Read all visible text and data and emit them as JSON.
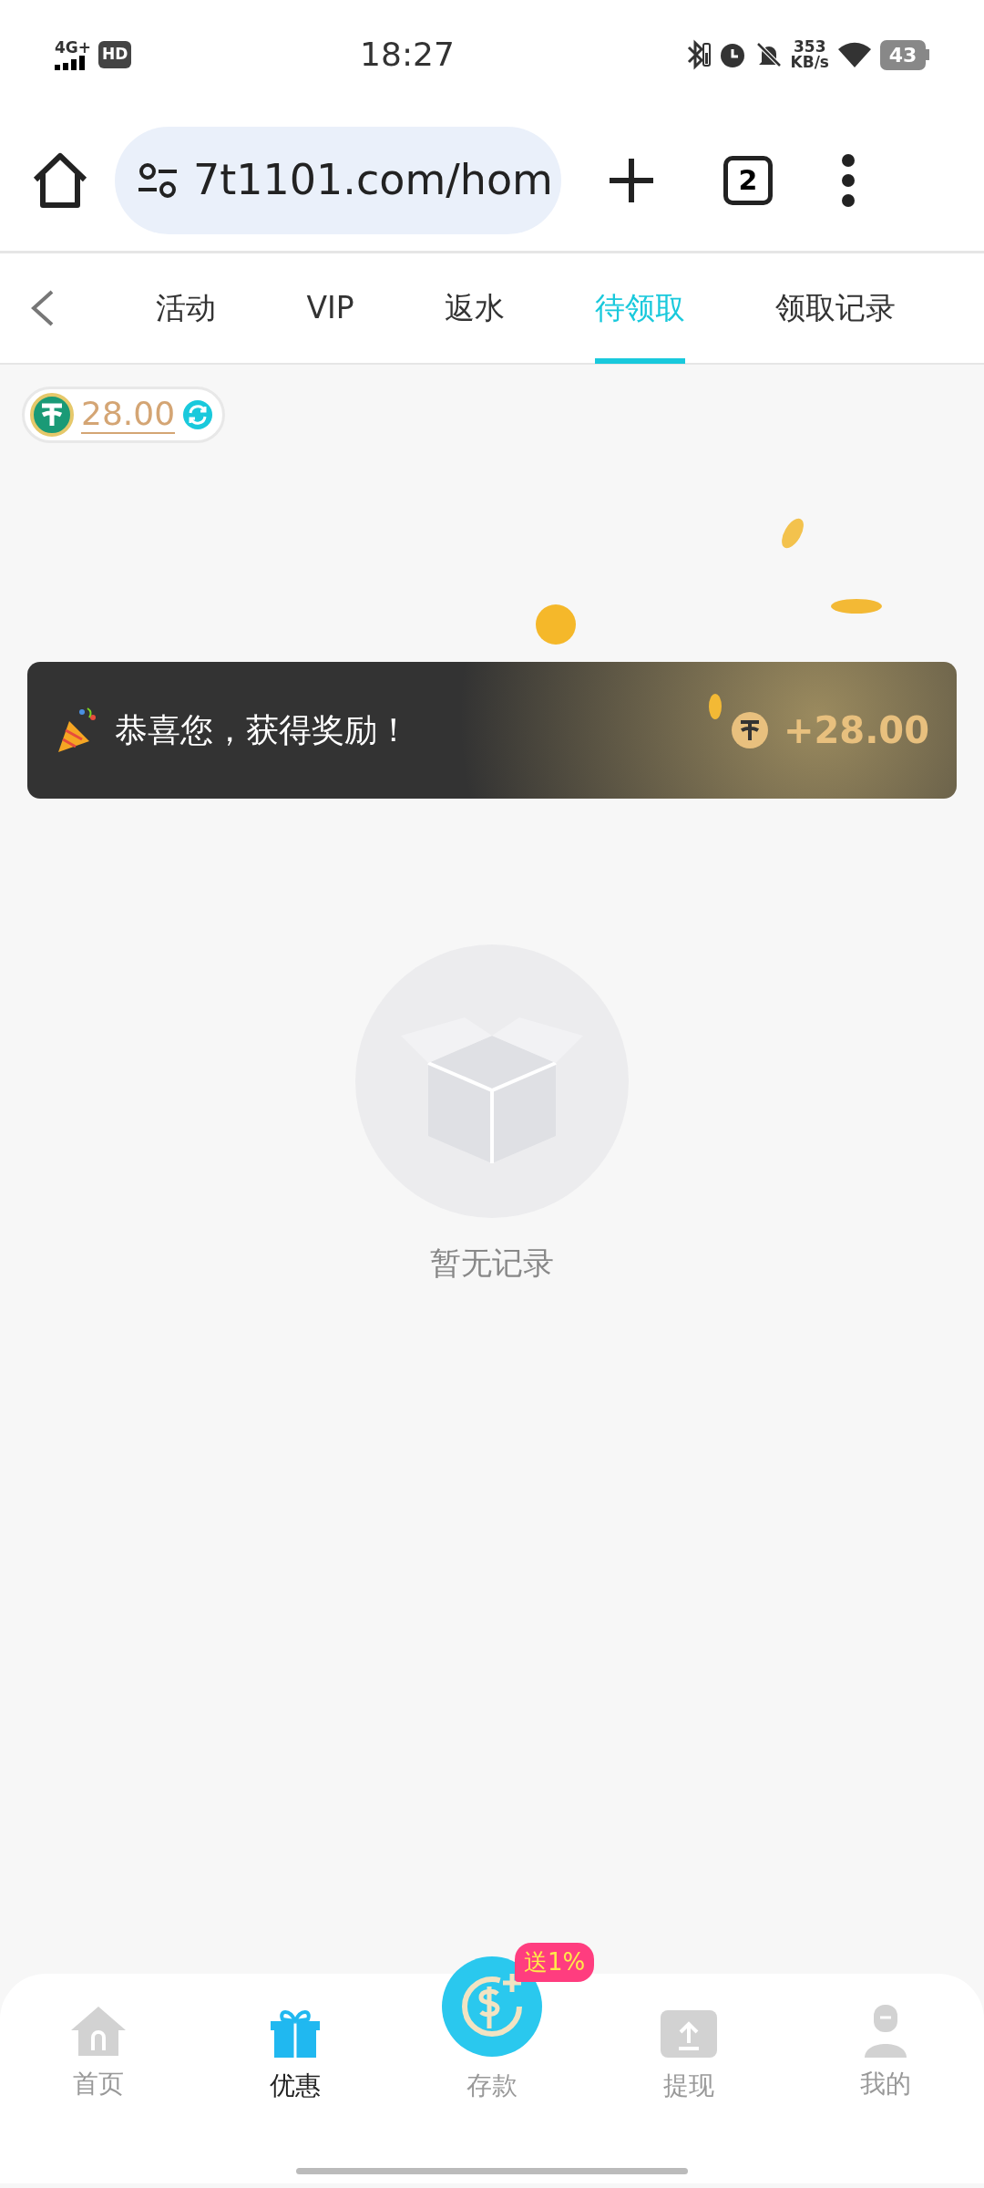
{
  "status_bar": {
    "network": "4G+",
    "hd": "HD",
    "time": "18:27",
    "speed": "353",
    "speed_unit": "KB/s",
    "battery": "43"
  },
  "browser": {
    "url": "7t1101.com/hom",
    "tab_count": "2"
  },
  "tabs": [
    {
      "label": "活动",
      "selected": false
    },
    {
      "label": "VIP",
      "selected": false
    },
    {
      "label": "返水",
      "selected": false
    },
    {
      "label": "待领取",
      "selected": true
    },
    {
      "label": "领取记录",
      "selected": false
    }
  ],
  "balance": {
    "amount": "28.00"
  },
  "toast": {
    "message": "恭喜您，获得奖励！",
    "reward": "+28.00"
  },
  "empty_state": {
    "text": "暂无记录"
  },
  "bottom_nav": [
    {
      "kind": "home",
      "label": "首页",
      "selected": false
    },
    {
      "kind": "gift",
      "label": "优惠",
      "selected": true
    },
    {
      "kind": "deposit",
      "label": "存款",
      "selected": false,
      "badge": "送1%"
    },
    {
      "kind": "withdraw",
      "label": "提现",
      "selected": false
    },
    {
      "kind": "profile",
      "label": "我的",
      "selected": false
    }
  ]
}
